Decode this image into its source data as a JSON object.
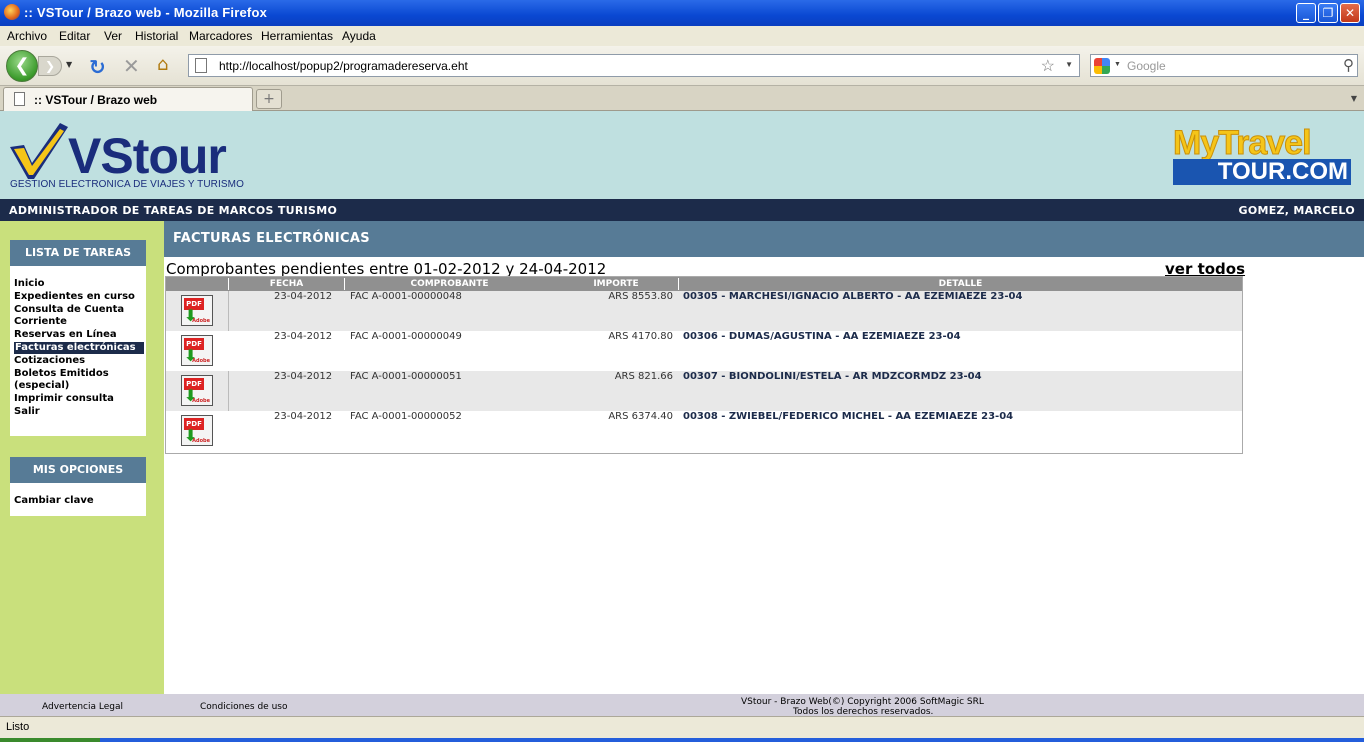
{
  "window": {
    "title": ":: VSTour / Brazo web - Mozilla Firefox"
  },
  "menubar": [
    "Archivo",
    "Editar",
    "Ver",
    "Historial",
    "Marcadores",
    "Herramientas",
    "Ayuda"
  ],
  "navbar": {
    "url": "http://localhost/popup2/programadereserva.eht",
    "search_placeholder": "Google"
  },
  "tabs": [
    {
      "label": ":: VSTour / Brazo web"
    }
  ],
  "header": {
    "logo_name": "VStour",
    "logo_tagline": "GESTION ELECTRONICA DE VIAJES Y TURISMO",
    "partner_logo_top": "MyTravel",
    "partner_logo_bottom": "TOUR.COM"
  },
  "adminbar": {
    "left": "ADMINISTRADOR DE TAREAS DE MARCOS TURISMO",
    "right": "GOMEZ, MARCELO"
  },
  "sidebar": {
    "tasks_title": "LISTA DE TAREAS",
    "tasks": [
      "Inicio",
      "Expedientes en curso",
      "Consulta de Cuenta Corriente",
      "Reservas en Línea",
      "Facturas electrónicas",
      "Cotizaciones",
      "Boletos Emitidos (especial)",
      "Imprimir consulta",
      "Salir"
    ],
    "active_task": "Facturas electrónicas",
    "options_title": "MIS OPCIONES",
    "options": [
      "Cambiar clave"
    ]
  },
  "main": {
    "section_title": "FACTURAS ELECTRÓNICAS",
    "subtitle": "Comprobantes pendientes entre 01-02-2012 y 24-04-2012",
    "view_all": "ver todos",
    "columns": [
      "",
      "FECHA",
      "COMPROBANTE",
      "IMPORTE",
      "DETALLE"
    ],
    "icon_label": "PDF",
    "rows": [
      {
        "fecha": "23-04-2012",
        "comprobante": "FAC A-0001-00000048",
        "importe": "ARS 8553.80",
        "detalle": "00305 - MARCHESI/IGNACIO ALBERTO - AA EZEMIAEZE 23-04"
      },
      {
        "fecha": "23-04-2012",
        "comprobante": "FAC A-0001-00000049",
        "importe": "ARS 4170.80",
        "detalle": "00306 - DUMAS/AGUSTINA - AA EZEMIAEZE 23-04"
      },
      {
        "fecha": "23-04-2012",
        "comprobante": "FAC A-0001-00000051",
        "importe": "ARS 821.66",
        "detalle": "00307 - BIONDOLINI/ESTELA - AR MDZCORMDZ 23-04"
      },
      {
        "fecha": "23-04-2012",
        "comprobante": "FAC A-0001-00000052",
        "importe": "ARS 6374.40",
        "detalle": "00308 - ZWIEBEL/FEDERICO MICHEL - AA EZEMIAEZE 23-04"
      }
    ]
  },
  "footer": {
    "legal": "Advertencia Legal",
    "terms": "Condiciones de uso",
    "copyright_line1": "VStour - Brazo Web(©) Copyright 2006 SoftMagic SRL",
    "copyright_line2": "Todos los derechos reservados."
  },
  "statusbar": {
    "text": "Listo"
  },
  "colors": {
    "header_bg": "#bfe0e0",
    "adminbar_bg": "#1c2b4a",
    "sidebar_bg": "#c9e07c",
    "section_bg": "#577b96"
  }
}
